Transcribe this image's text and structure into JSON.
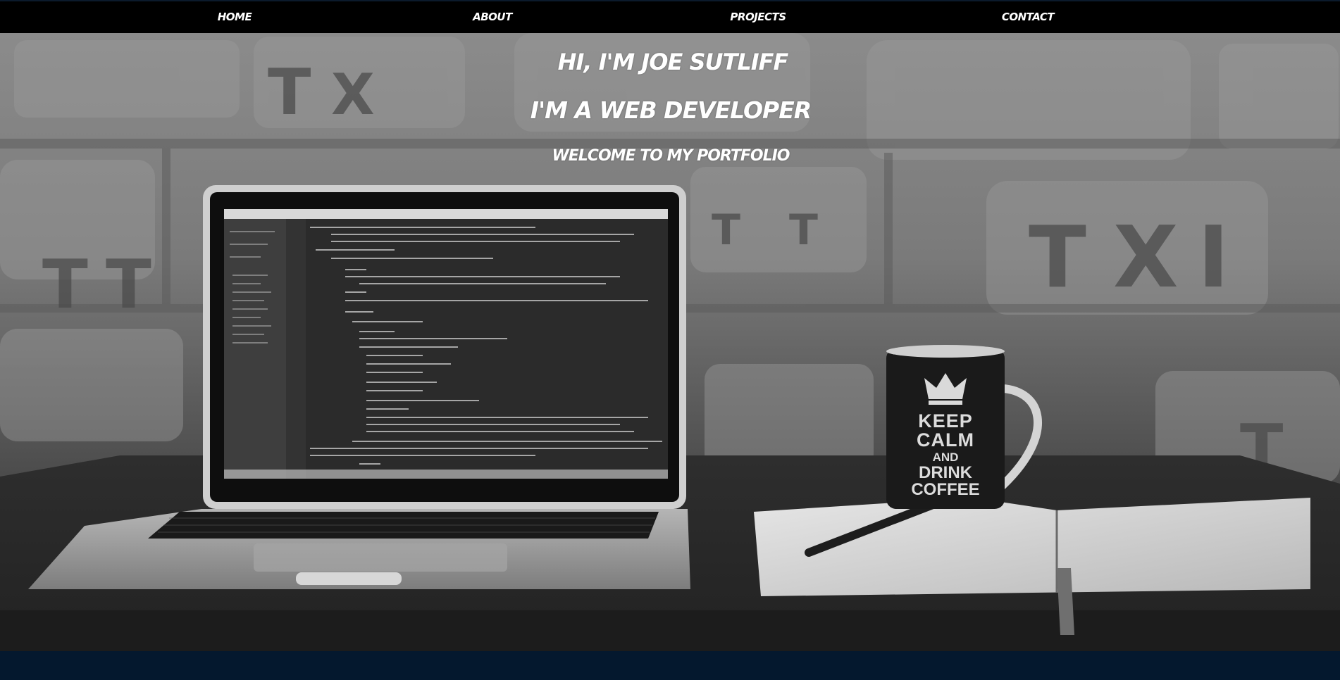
{
  "nav": {
    "items": [
      {
        "label": "HOME"
      },
      {
        "label": "ABOUT"
      },
      {
        "label": "PROJECTS"
      },
      {
        "label": "CONTACT"
      }
    ]
  },
  "hero": {
    "greeting": "HI, I'M JOE SUTLIFF",
    "role": "I'M A WEB DEVELOPER",
    "welcome": "WELCOME TO MY PORTFOLIO",
    "mug_text": [
      "KEEP",
      "CALM",
      "AND",
      "DRINK",
      "COFFEE"
    ]
  },
  "colors": {
    "nav_background": "#000000",
    "footer_band": "#04182e",
    "text": "#ffffff"
  }
}
